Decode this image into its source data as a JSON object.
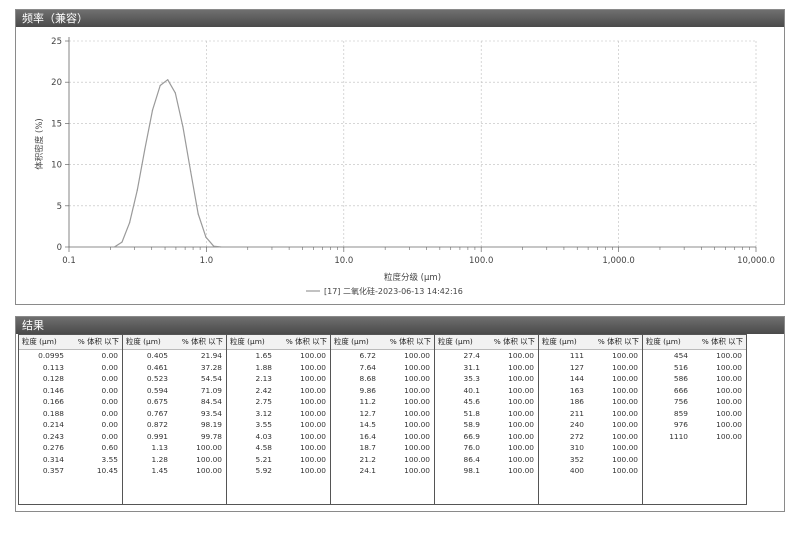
{
  "freq_panel": {
    "title": "频率（兼容）"
  },
  "result_panel": {
    "title": "结果"
  },
  "chart_data": {
    "type": "line",
    "title": "",
    "xlabel": "粒度分级 (µm)",
    "ylabel": "体积密度 (%)",
    "xscale": "log",
    "xlim": [
      0.1,
      10000
    ],
    "ylim": [
      0,
      25
    ],
    "xticks": [
      0.1,
      1,
      10,
      100,
      1000,
      10000
    ],
    "xtick_labels": [
      "0.1",
      "1.0",
      "10.0",
      "100.0",
      "1,000.0",
      "10,000.0"
    ],
    "yticks": [
      0,
      5,
      10,
      15,
      20,
      25
    ],
    "ytick_labels": [
      "0",
      "5",
      "10",
      "15",
      "20",
      "25"
    ],
    "grid": true,
    "legend": "bottom-center",
    "series": [
      {
        "name": "[17] 二氧化硅-2023-06-13 14:42:16",
        "color": "#9a9a9a",
        "x": [
          0.214,
          0.243,
          0.276,
          0.314,
          0.357,
          0.405,
          0.461,
          0.523,
          0.594,
          0.675,
          0.767,
          0.872,
          0.991,
          1.13,
          1.28
        ],
        "y": [
          0.0,
          0.6,
          2.95,
          6.9,
          11.9,
          16.6,
          19.6,
          20.3,
          18.7,
          14.6,
          9.2,
          4.0,
          1.2,
          0.1,
          0.0
        ]
      }
    ]
  },
  "table": {
    "header_size": "粒度 (µm)",
    "header_pct": "% 体积 以下",
    "columns": [
      [
        [
          "0.0995",
          "0.00"
        ],
        [
          "0.113",
          "0.00"
        ],
        [
          "0.128",
          "0.00"
        ],
        [
          "0.146",
          "0.00"
        ],
        [
          "0.166",
          "0.00"
        ],
        [
          "0.188",
          "0.00"
        ],
        [
          "0.214",
          "0.00"
        ],
        [
          "0.243",
          "0.00"
        ],
        [
          "0.276",
          "0.60"
        ],
        [
          "0.314",
          "3.55"
        ],
        [
          "0.357",
          "10.45"
        ]
      ],
      [
        [
          "0.405",
          "21.94"
        ],
        [
          "0.461",
          "37.28"
        ],
        [
          "0.523",
          "54.54"
        ],
        [
          "0.594",
          "71.09"
        ],
        [
          "0.675",
          "84.54"
        ],
        [
          "0.767",
          "93.54"
        ],
        [
          "0.872",
          "98.19"
        ],
        [
          "0.991",
          "99.78"
        ],
        [
          "1.13",
          "100.00"
        ],
        [
          "1.28",
          "100.00"
        ],
        [
          "1.45",
          "100.00"
        ]
      ],
      [
        [
          "1.65",
          "100.00"
        ],
        [
          "1.88",
          "100.00"
        ],
        [
          "2.13",
          "100.00"
        ],
        [
          "2.42",
          "100.00"
        ],
        [
          "2.75",
          "100.00"
        ],
        [
          "3.12",
          "100.00"
        ],
        [
          "3.55",
          "100.00"
        ],
        [
          "4.03",
          "100.00"
        ],
        [
          "4.58",
          "100.00"
        ],
        [
          "5.21",
          "100.00"
        ],
        [
          "5.92",
          "100.00"
        ]
      ],
      [
        [
          "6.72",
          "100.00"
        ],
        [
          "7.64",
          "100.00"
        ],
        [
          "8.68",
          "100.00"
        ],
        [
          "9.86",
          "100.00"
        ],
        [
          "11.2",
          "100.00"
        ],
        [
          "12.7",
          "100.00"
        ],
        [
          "14.5",
          "100.00"
        ],
        [
          "16.4",
          "100.00"
        ],
        [
          "18.7",
          "100.00"
        ],
        [
          "21.2",
          "100.00"
        ],
        [
          "24.1",
          "100.00"
        ]
      ],
      [
        [
          "27.4",
          "100.00"
        ],
        [
          "31.1",
          "100.00"
        ],
        [
          "35.3",
          "100.00"
        ],
        [
          "40.1",
          "100.00"
        ],
        [
          "45.6",
          "100.00"
        ],
        [
          "51.8",
          "100.00"
        ],
        [
          "58.9",
          "100.00"
        ],
        [
          "66.9",
          "100.00"
        ],
        [
          "76.0",
          "100.00"
        ],
        [
          "86.4",
          "100.00"
        ],
        [
          "98.1",
          "100.00"
        ]
      ],
      [
        [
          "111",
          "100.00"
        ],
        [
          "127",
          "100.00"
        ],
        [
          "144",
          "100.00"
        ],
        [
          "163",
          "100.00"
        ],
        [
          "186",
          "100.00"
        ],
        [
          "211",
          "100.00"
        ],
        [
          "240",
          "100.00"
        ],
        [
          "272",
          "100.00"
        ],
        [
          "310",
          "100.00"
        ],
        [
          "352",
          "100.00"
        ],
        [
          "400",
          "100.00"
        ]
      ],
      [
        [
          "454",
          "100.00"
        ],
        [
          "516",
          "100.00"
        ],
        [
          "586",
          "100.00"
        ],
        [
          "666",
          "100.00"
        ],
        [
          "756",
          "100.00"
        ],
        [
          "859",
          "100.00"
        ],
        [
          "976",
          "100.00"
        ],
        [
          "1110",
          "100.00"
        ]
      ]
    ]
  }
}
